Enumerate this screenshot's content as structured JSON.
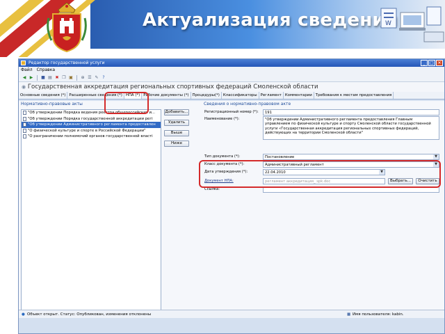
{
  "banner": {
    "title": "Актуализация сведений"
  },
  "window": {
    "title": "Редактор государственной услуги",
    "buttons": [
      "_",
      "□",
      "✕"
    ]
  },
  "menu": [
    "Файл",
    "Справка"
  ],
  "toolbar_icons": [
    "back-icon",
    "forward-icon",
    "save-icon",
    "print-icon",
    "delete-icon",
    "copy-icon",
    "paste-icon",
    "attach-icon",
    "list-icon",
    "edit-icon",
    "help-icon"
  ],
  "document_title": "Государственная аккредитация региональных спортивных федераций Смоленской области",
  "tabs": [
    "Основные сведения (*)",
    "Расширенные сведения (*)",
    "НПА (*)",
    "Рабочие документы (*)",
    "Процедуры(*)",
    "Классификаторы",
    "Регламент",
    "Комментарии",
    "Требования к местам предоставления"
  ],
  "left_panel": {
    "header": "Нормативно-правовые акты",
    "items": [
      "\"Об утверждении Порядка ведения реестра общероссийских и...",
      "\"Об утверждении Порядка государственной аккредитации регі",
      "\"Об утверждении Административного регламента предоставлен",
      "\"О физической культуре и спорте в Российской Федерации\"",
      "\"О разграничении полномочий органов государственной власті"
    ],
    "selected_index": 2,
    "buttons": [
      "Добавить...",
      "Удалить",
      "Выше",
      "Ниже"
    ]
  },
  "right_panel": {
    "header": "Сведения о нормативно-правовом акте",
    "reg_number_label": "Регистрационный номер (*):",
    "reg_number_value": "191",
    "name_label": "Наименование (*):",
    "name_value": "\"Об утверждении Административного регламента предоставления Главным управлением по физической культуре и спорту Смоленской области государственной услуги «Государственная аккредитация региональных спортивных федераций, действующих на территории Смоленской области\"",
    "doc_type_label": "Тип документа (*):",
    "doc_type_value": "Постановление",
    "doc_class_label": "Класс документа (*):",
    "doc_class_value": "Административный регламент",
    "approval_date_label": "Дата утверждения (*):",
    "approval_date_value": "22.04.2010",
    "document_label": "Документ НПА:",
    "document_value": "регламент аккредитация_ spk.doc",
    "select_button": "Выбрать...",
    "clear_button": "Очистить",
    "link_label": "Ссылка:"
  },
  "status": {
    "left": "Объект открыт. Статус: Опубликован, изменения отклонены",
    "right": "Имя пользователя: kabin."
  },
  "colors": {
    "banner_blue": "#2a5db0",
    "highlight_red": "#d42a2a",
    "selection": "#316ac5",
    "panel_header": "#1e4c9a"
  }
}
